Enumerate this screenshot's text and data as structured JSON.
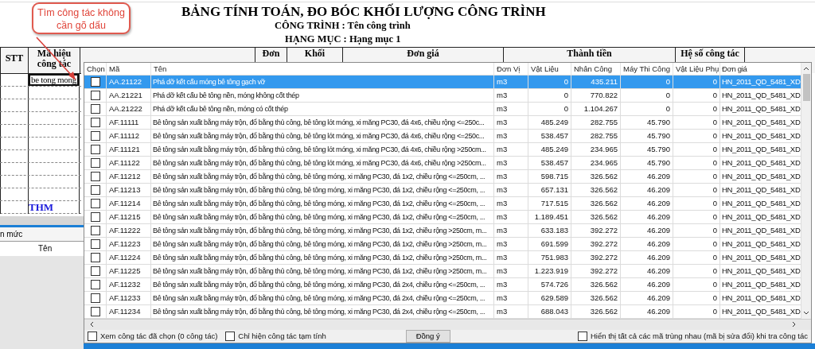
{
  "sheet": {
    "title": "BẢNG TÍNH TOÁN, ĐO BÓC KHỐI LƯỢNG CÔNG TRÌNH",
    "project": "CÔNG TRÌNH : Tên công trình",
    "category": "HẠNG MỤC : Hạng mục 1",
    "columns": [
      "STT",
      "Mã hiệu công tác",
      "Đơn",
      "Khối",
      "Đơn giá",
      "Thành tiền",
      "Hệ số công tác"
    ],
    "code_input": "be tong mong",
    "total_label": "THM"
  },
  "side_panel": {
    "title": "n mức",
    "column": "Tên"
  },
  "callout": {
    "text": "Tìm công tác không cần gõ dấu"
  },
  "picker": {
    "columns": [
      "Chọn",
      "Mã",
      "Tên",
      "Đơn Vị",
      "Vật Liệu",
      "Nhân Công",
      "Máy Thi Công",
      "Vật Liệu Phụ",
      "Đơn giá"
    ],
    "rows": [
      {
        "checked": false,
        "selected": true,
        "code": "AA.21122",
        "name": "Phá dỡ kết cấu móng bê tông gạch vỡ",
        "unit": "m3",
        "material": "0",
        "labor": "435.211",
        "machine": "0",
        "extra": "0",
        "price": "HN_2011_QD_5481_XD"
      },
      {
        "checked": false,
        "selected": false,
        "code": "AA.21221",
        "name": "Phá dỡ kết cấu bê tông nền, móng không cốt thép",
        "unit": "m3",
        "material": "0",
        "labor": "770.822",
        "machine": "0",
        "extra": "0",
        "price": "HN_2011_QD_5481_XD"
      },
      {
        "checked": false,
        "selected": false,
        "code": "AA.21222",
        "name": "Phá dỡ kết cấu bê tông nền, móng có cốt thép",
        "unit": "m3",
        "material": "0",
        "labor": "1.104.267",
        "machine": "0",
        "extra": "0",
        "price": "HN_2011_QD_5481_XD"
      },
      {
        "checked": false,
        "selected": false,
        "code": "AF.11111",
        "name": "Bê tông sản xuất bằng máy trộn, đổ bằng thủ công, bê tông lót móng, xi măng PC30, đá 4x6, chiều rộng <=250c...",
        "unit": "m3",
        "material": "485.249",
        "labor": "282.755",
        "machine": "45.790",
        "extra": "0",
        "price": "HN_2011_QD_5481_XD"
      },
      {
        "checked": false,
        "selected": false,
        "code": "AF.11112",
        "name": "Bê tông sản xuất bằng máy trộn, đổ bằng thủ công, bê tông lót móng, xi măng PC30, đá 4x6, chiều rộng <=250c...",
        "unit": "m3",
        "material": "538.457",
        "labor": "282.755",
        "machine": "45.790",
        "extra": "0",
        "price": "HN_2011_QD_5481_XD"
      },
      {
        "checked": false,
        "selected": false,
        "code": "AF.11121",
        "name": "Bê tông sản xuất bằng máy trộn, đổ bằng thủ công, bê tông lót móng, xi măng PC30, đá 4x6, chiều rộng >250cm...",
        "unit": "m3",
        "material": "485.249",
        "labor": "234.965",
        "machine": "45.790",
        "extra": "0",
        "price": "HN_2011_QD_5481_XD"
      },
      {
        "checked": false,
        "selected": false,
        "code": "AF.11122",
        "name": "Bê tông sản xuất bằng máy trộn, đổ bằng thủ công, bê tông lót móng, xi măng PC30, đá 4x6, chiều rộng >250cm...",
        "unit": "m3",
        "material": "538.457",
        "labor": "234.965",
        "machine": "45.790",
        "extra": "0",
        "price": "HN_2011_QD_5481_XD"
      },
      {
        "checked": false,
        "selected": false,
        "code": "AF.11212",
        "name": "Bê tông sản xuất bằng máy trộn, đổ bằng thủ công, bê tông móng, xi măng PC30, đá 1x2, chiều rộng <=250cm, ...",
        "unit": "m3",
        "material": "598.715",
        "labor": "326.562",
        "machine": "46.209",
        "extra": "0",
        "price": "HN_2011_QD_5481_XD"
      },
      {
        "checked": false,
        "selected": false,
        "code": "AF.11213",
        "name": "Bê tông sản xuất bằng máy trộn, đổ bằng thủ công, bê tông móng, xi măng PC30, đá 1x2, chiều rộng <=250cm, ...",
        "unit": "m3",
        "material": "657.131",
        "labor": "326.562",
        "machine": "46.209",
        "extra": "0",
        "price": "HN_2011_QD_5481_XD"
      },
      {
        "checked": false,
        "selected": false,
        "code": "AF.11214",
        "name": "Bê tông sản xuất bằng máy trộn, đổ bằng thủ công, bê tông móng, xi măng PC30, đá 1x2, chiều rộng <=250cm, ...",
        "unit": "m3",
        "material": "717.515",
        "labor": "326.562",
        "machine": "46.209",
        "extra": "0",
        "price": "HN_2011_QD_5481_XD"
      },
      {
        "checked": false,
        "selected": false,
        "code": "AF.11215",
        "name": "Bê tông sản xuất bằng máy trộn, đổ bằng thủ công, bê tông móng, xi măng PC30, đá 1x2, chiều rộng <=250cm, ...",
        "unit": "m3",
        "material": "1.189.451",
        "labor": "326.562",
        "machine": "46.209",
        "extra": "0",
        "price": "HN_2011_QD_5481_XD"
      },
      {
        "checked": false,
        "selected": false,
        "code": "AF.11222",
        "name": "Bê tông sản xuất bằng máy trộn, đổ bằng thủ công, bê tông móng, xi măng PC30, đá 1x2, chiều rộng >250cm, m...",
        "unit": "m3",
        "material": "633.183",
        "labor": "392.272",
        "machine": "46.209",
        "extra": "0",
        "price": "HN_2011_QD_5481_XD"
      },
      {
        "checked": false,
        "selected": false,
        "code": "AF.11223",
        "name": "Bê tông sản xuất bằng máy trộn, đổ bằng thủ công, bê tông móng, xi măng PC30, đá 1x2, chiều rộng >250cm, m...",
        "unit": "m3",
        "material": "691.599",
        "labor": "392.272",
        "machine": "46.209",
        "extra": "0",
        "price": "HN_2011_QD_5481_XD"
      },
      {
        "checked": false,
        "selected": false,
        "code": "AF.11224",
        "name": "Bê tông sản xuất bằng máy trộn, đổ bằng thủ công, bê tông móng, xi măng PC30, đá 1x2, chiều rộng >250cm, m...",
        "unit": "m3",
        "material": "751.983",
        "labor": "392.272",
        "machine": "46.209",
        "extra": "0",
        "price": "HN_2011_QD_5481_XD"
      },
      {
        "checked": false,
        "selected": false,
        "code": "AF.11225",
        "name": "Bê tông sản xuất bằng máy trộn, đổ bằng thủ công, bê tông móng, xi măng PC30, đá 1x2, chiều rộng >250cm, m...",
        "unit": "m3",
        "material": "1.223.919",
        "labor": "392.272",
        "machine": "46.209",
        "extra": "0",
        "price": "HN_2011_QD_5481_XD"
      },
      {
        "checked": false,
        "selected": false,
        "code": "AF.11232",
        "name": "Bê tông sản xuất bằng máy trộn, đổ bằng thủ công, bê tông móng, xi măng PC30, đá 2x4, chiều rộng <=250cm, ...",
        "unit": "m3",
        "material": "574.726",
        "labor": "326.562",
        "machine": "46.209",
        "extra": "0",
        "price": "HN_2011_QD_5481_XD"
      },
      {
        "checked": false,
        "selected": false,
        "code": "AF.11233",
        "name": "Bê tông sản xuất bằng máy trộn, đổ bằng thủ công, bê tông móng, xi măng PC30, đá 2x4, chiều rộng <=250cm, ...",
        "unit": "m3",
        "material": "629.589",
        "labor": "326.562",
        "machine": "46.209",
        "extra": "0",
        "price": "HN_2011_QD_5481_XD"
      },
      {
        "checked": false,
        "selected": false,
        "code": "AF.11234",
        "name": "Bê tông sản xuất bằng máy trộn, đổ bằng thủ công, bê tông móng, xi măng PC30, đá 2x4, chiều rộng <=250cm, ...",
        "unit": "m3",
        "material": "688.043",
        "labor": "326.562",
        "machine": "46.209",
        "extra": "0",
        "price": "HN_2011_QD_5481_XD"
      }
    ],
    "footer_options": [
      {
        "label": "Xem công tác đã chọn (0 công tác)",
        "checked": false
      },
      {
        "label": "Chỉ hiện công tác tạm tính",
        "checked": false
      }
    ],
    "confirm_button": "Đồng ý",
    "duplicate_option": {
      "label": "Hiển thị tất cả các mã trùng nhau (mã bị sửa đổi) khi tra công tác",
      "checked": false
    }
  }
}
